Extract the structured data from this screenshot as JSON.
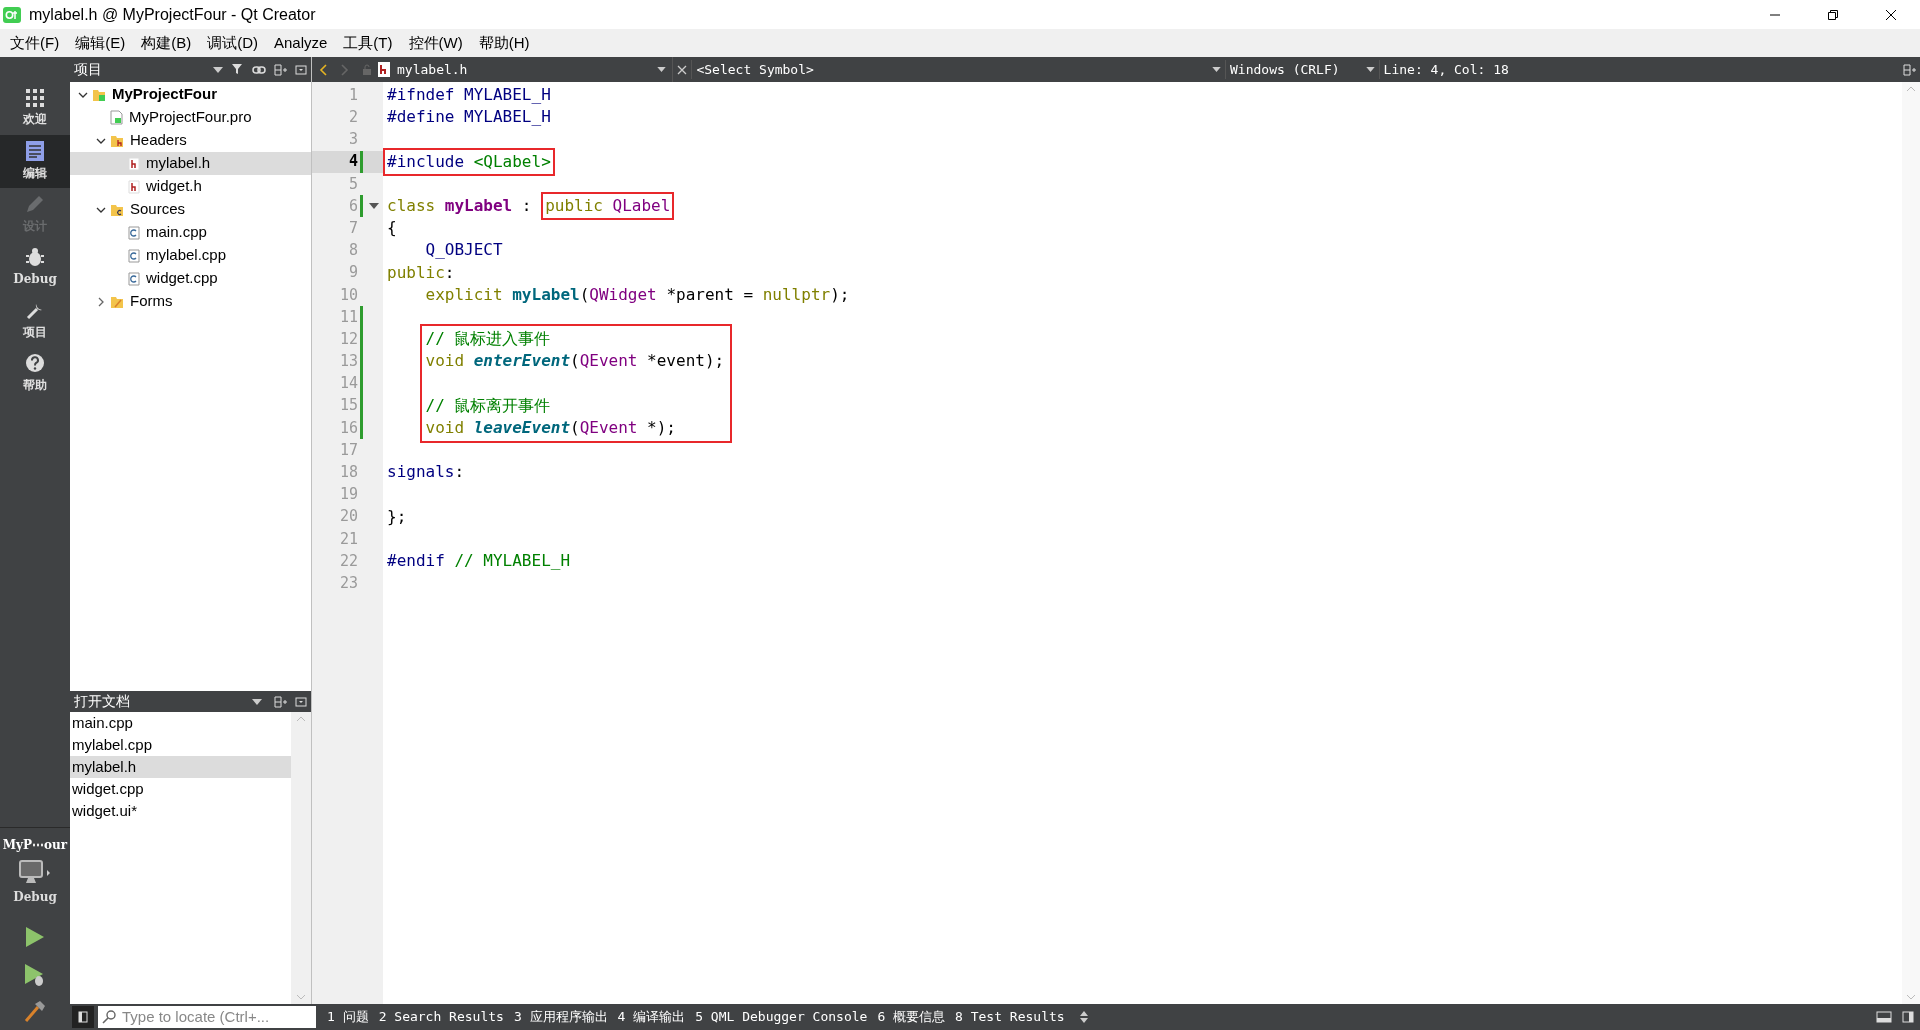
{
  "window": {
    "title": "mylabel.h @ MyProjectFour - Qt Creator"
  },
  "menu": [
    "文件(F)",
    "编辑(E)",
    "构建(B)",
    "调试(D)",
    "Analyze",
    "工具(T)",
    "控件(W)",
    "帮助(H)"
  ],
  "modes": [
    {
      "kind": "welcome",
      "label": "欢迎",
      "selected": false,
      "disabled": false
    },
    {
      "kind": "edit",
      "label": "编辑",
      "selected": true,
      "disabled": false
    },
    {
      "kind": "design",
      "label": "设计",
      "selected": false,
      "disabled": true
    },
    {
      "kind": "debug",
      "label": "Debug",
      "selected": false,
      "disabled": false
    },
    {
      "kind": "projects",
      "label": "项目",
      "selected": false,
      "disabled": false
    },
    {
      "kind": "help",
      "label": "帮助",
      "selected": false,
      "disabled": false
    }
  ],
  "kit": {
    "project": "MyP⋯our",
    "build": "Debug"
  },
  "projects_panel": {
    "title": "项目",
    "tree": [
      {
        "kind": "project",
        "label": "MyProjectFour",
        "expanded": true,
        "selected": false,
        "children": [
          {
            "kind": "pro",
            "label": "MyProjectFour.pro",
            "selected": false
          },
          {
            "kind": "headers",
            "label": "Headers",
            "expanded": true,
            "selected": false,
            "children": [
              {
                "kind": "h",
                "label": "mylabel.h",
                "selected": true
              },
              {
                "kind": "h",
                "label": "widget.h",
                "selected": false
              }
            ]
          },
          {
            "kind": "sources",
            "label": "Sources",
            "expanded": true,
            "selected": false,
            "children": [
              {
                "kind": "cpp",
                "label": "main.cpp",
                "selected": false
              },
              {
                "kind": "cpp",
                "label": "mylabel.cpp",
                "selected": false
              },
              {
                "kind": "cpp",
                "label": "widget.cpp",
                "selected": false
              }
            ]
          },
          {
            "kind": "forms",
            "label": "Forms",
            "expanded": false,
            "selected": false
          }
        ]
      }
    ]
  },
  "open_documents": {
    "title": "打开文档",
    "items": [
      {
        "label": "main.cpp",
        "selected": false
      },
      {
        "label": "mylabel.cpp",
        "selected": false
      },
      {
        "label": "mylabel.h",
        "selected": true
      },
      {
        "label": "widget.cpp",
        "selected": false
      },
      {
        "label": "widget.ui*",
        "selected": false
      }
    ]
  },
  "editor": {
    "file": "mylabel.h",
    "symbol": "<Select Symbol>",
    "line_ending": "Windows (CRLF)",
    "position": "Line: 4, Col: 18",
    "blocks": [
      {
        "kind": "line",
        "number": "1",
        "current": false,
        "modified": false,
        "foldable": false,
        "tokens": [
          {
            "kind": "pp",
            "text": "#ifndef MYLABEL_H"
          }
        ]
      },
      {
        "kind": "line",
        "number": "2",
        "current": false,
        "modified": false,
        "foldable": false,
        "tokens": [
          {
            "kind": "pp",
            "text": "#define MYLABEL_H"
          }
        ]
      },
      {
        "kind": "line",
        "number": "3",
        "current": false,
        "modified": false,
        "foldable": false
      },
      {
        "kind": "line",
        "number": "4",
        "current": true,
        "modified": true,
        "foldable": false,
        "tokens": [
          {
            "kind": "boxed",
            "tokens": [
              {
                "kind": "pp",
                "text": "#include "
              },
              {
                "kind": "inc",
                "text": "<QLabel>"
              }
            ]
          }
        ]
      },
      {
        "kind": "line",
        "number": "5",
        "current": false,
        "modified": false,
        "foldable": false
      },
      {
        "kind": "line",
        "number": "6",
        "current": false,
        "modified": true,
        "foldable": true,
        "tokens": [
          {
            "kind": "kw",
            "text": "class "
          },
          {
            "kind": "cls",
            "text": "myLabel"
          },
          {
            "kind": "plain",
            "text": " : "
          },
          {
            "kind": "boxed",
            "tokens": [
              {
                "kind": "kw",
                "text": "public "
              },
              {
                "kind": "type",
                "text": "QLabel"
              }
            ]
          }
        ]
      },
      {
        "kind": "line",
        "number": "7",
        "current": false,
        "modified": false,
        "foldable": false,
        "tokens": [
          {
            "kind": "plain",
            "text": "{"
          }
        ]
      },
      {
        "kind": "line",
        "number": "8",
        "current": false,
        "modified": false,
        "foldable": false,
        "tokens": [
          {
            "kind": "pp",
            "text": "    Q_OBJECT"
          }
        ]
      },
      {
        "kind": "line",
        "number": "9",
        "current": false,
        "modified": false,
        "foldable": false,
        "tokens": [
          {
            "kind": "kw",
            "text": "public"
          },
          {
            "kind": "plain",
            "text": ":"
          }
        ]
      },
      {
        "kind": "line",
        "number": "10",
        "current": false,
        "modified": false,
        "foldable": false,
        "tokens": [
          {
            "kind": "kw",
            "text": "    explicit "
          },
          {
            "kind": "ctor",
            "text": "myLabel"
          },
          {
            "kind": "plain",
            "text": "("
          },
          {
            "kind": "type",
            "text": "QWidget"
          },
          {
            "kind": "plain",
            "text": " *parent = "
          },
          {
            "kind": "kw",
            "text": "nullptr"
          },
          {
            "kind": "plain",
            "text": ");"
          }
        ]
      },
      {
        "kind": "line",
        "number": "11",
        "current": false,
        "modified": true,
        "foldable": false
      },
      {
        "kind": "boxed_group",
        "lines": [
          {
            "kind": "line",
            "number": "12",
            "current": false,
            "modified": true,
            "foldable": false,
            "tokens": [
              {
                "kind": "cm",
                "text": "// 鼠标进入事件"
              }
            ]
          },
          {
            "kind": "line",
            "number": "13",
            "current": false,
            "modified": true,
            "foldable": false,
            "tokens": [
              {
                "kind": "kw",
                "text": "void "
              },
              {
                "kind": "fn",
                "text": "enterEvent"
              },
              {
                "kind": "plain",
                "text": "("
              },
              {
                "kind": "type",
                "text": "QEvent"
              },
              {
                "kind": "plain",
                "text": " *event);"
              }
            ]
          },
          {
            "kind": "line",
            "number": "14",
            "current": false,
            "modified": true,
            "foldable": false
          },
          {
            "kind": "line",
            "number": "15",
            "current": false,
            "modified": true,
            "foldable": false,
            "tokens": [
              {
                "kind": "cm",
                "text": "// 鼠标离开事件"
              }
            ]
          },
          {
            "kind": "line",
            "number": "16",
            "current": false,
            "modified": true,
            "foldable": false,
            "tokens": [
              {
                "kind": "kw",
                "text": "void "
              },
              {
                "kind": "fn",
                "text": "leaveEvent"
              },
              {
                "kind": "plain",
                "text": "("
              },
              {
                "kind": "type",
                "text": "QEvent"
              },
              {
                "kind": "plain",
                "text": " *);"
              }
            ]
          }
        ]
      },
      {
        "kind": "line",
        "number": "17",
        "current": false,
        "modified": false,
        "foldable": false
      },
      {
        "kind": "line",
        "number": "18",
        "current": false,
        "modified": false,
        "foldable": false,
        "tokens": [
          {
            "kind": "pp",
            "text": "signals"
          },
          {
            "kind": "plain",
            "text": ":"
          }
        ]
      },
      {
        "kind": "line",
        "number": "19",
        "current": false,
        "modified": false,
        "foldable": false
      },
      {
        "kind": "line",
        "number": "20",
        "current": false,
        "modified": false,
        "foldable": false,
        "tokens": [
          {
            "kind": "plain",
            "text": "};"
          }
        ]
      },
      {
        "kind": "line",
        "number": "21",
        "current": false,
        "modified": false,
        "foldable": false
      },
      {
        "kind": "line",
        "number": "22",
        "current": false,
        "modified": false,
        "foldable": false,
        "tokens": [
          {
            "kind": "pp",
            "text": "#endif "
          },
          {
            "kind": "cm",
            "text": "// MYLABEL_H"
          }
        ]
      },
      {
        "kind": "line",
        "number": "23",
        "current": false,
        "modified": false,
        "foldable": false
      }
    ]
  },
  "status_bar": {
    "locate": {
      "placeholder": "Type to locate (Ctrl+..."
    },
    "panes": [
      "1 问题",
      "2 Search Results",
      "3 应用程序输出",
      "4 编译输出",
      "5 QML Debugger Console",
      "6 概要信息",
      "8 Test Results"
    ]
  }
}
